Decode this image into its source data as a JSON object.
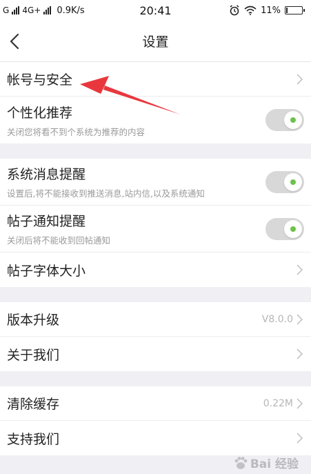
{
  "status_bar": {
    "carrier1": "G",
    "carrier2": "4G+",
    "speed": "0.9K/s",
    "time": "20:41",
    "battery": "11%",
    "battery_level": 0.11
  },
  "nav": {
    "title": "设置"
  },
  "groups": {
    "g1": {
      "account_security": "帐号与安全",
      "personal_rec_title": "个性化推荐",
      "personal_rec_sub": "关闭您将看不到个系统为推荐的内容"
    },
    "g2": {
      "sys_msg_title": "系统消息提醒",
      "sys_msg_sub": "设置后,将不能接收到推送消息,站内信,以及系统通知",
      "post_notice_title": "帖子通知提醒",
      "post_notice_sub": "关闭后将不能收到回帖通知",
      "font_size": "帖子字体大小"
    },
    "g3": {
      "version_upgrade": "版本升级",
      "version_value": "V8.0.0",
      "about_us": "关于我们"
    },
    "g4": {
      "clear_cache": "清除缓存",
      "cache_value": "0.22M",
      "support_us": "支持我们"
    }
  },
  "watermark": "Bai 经验",
  "colors": {
    "toggle_dot": "#6cc24a",
    "arrow": "#e8383d"
  }
}
